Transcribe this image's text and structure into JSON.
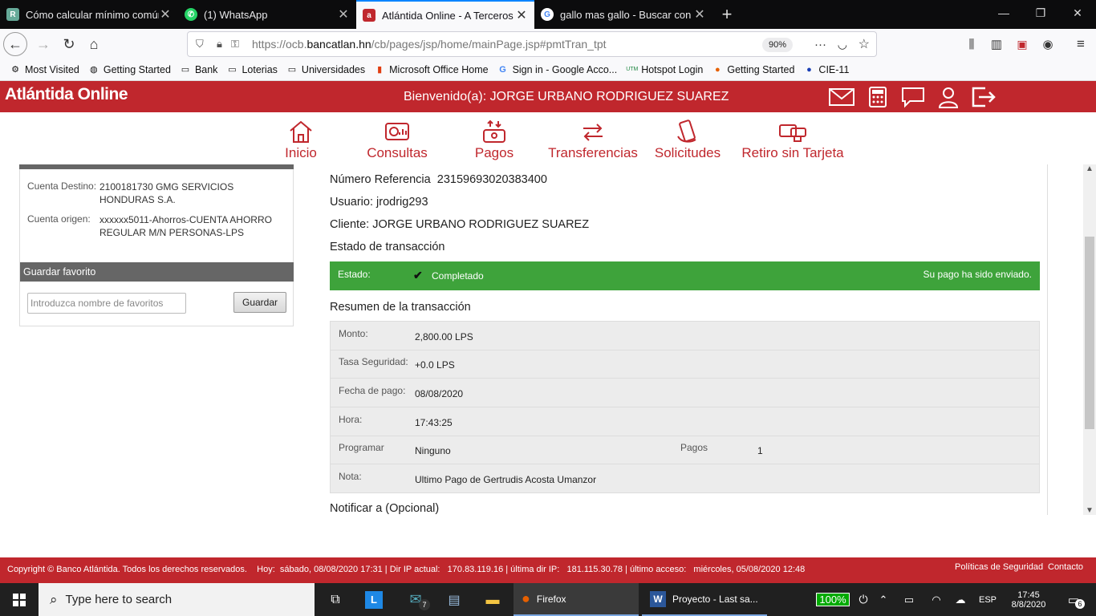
{
  "browser": {
    "tabs": [
      {
        "title": "Cómo calcular mínimo común",
        "icon": "r-favicon",
        "active": false
      },
      {
        "title": "(1) WhatsApp",
        "icon": "whatsapp-icon",
        "active": false
      },
      {
        "title": "Atlántida Online - A Terceros",
        "icon": "atlantida-icon",
        "active": true
      },
      {
        "title": "gallo mas gallo - Buscar con G",
        "icon": "google-icon",
        "active": false
      }
    ],
    "url_prefix": "https://ocb.",
    "url_domain": "bancatlan.hn",
    "url_path": "/cb/pages/jsp/home/mainPage.jsp#pmtTran_tpt",
    "zoom": "90%",
    "bookmarks": [
      "Most Visited",
      "Getting Started",
      "Bank",
      "Loterias",
      "Universidades",
      "Microsoft Office Home",
      "Sign in - Google Acco...",
      "Hotspot Login",
      "Getting Started",
      "CIE-11"
    ]
  },
  "site": {
    "logo": "Atlántida Online",
    "welcome": "Bienvenido(a): JORGE URBANO RODRIGUEZ SUAREZ",
    "menu": [
      "Inicio",
      "Consultas",
      "Pagos",
      "Transferencias",
      "Solicitudes",
      "Retiro sin Tarjeta"
    ]
  },
  "left": {
    "dest_label": "Cuenta Destino:",
    "dest_value": "2100181730 GMG SERVICIOS HONDURAS S.A.",
    "orig_label": "Cuenta origen:",
    "orig_value": "xxxxxx5011-Ahorros-CUENTA AHORRO REGULAR M/N PERSONAS-LPS",
    "fav_header": "Guardar favorito",
    "fav_placeholder": "Introduzca nombre de favoritos",
    "fav_button": "Guardar"
  },
  "main": {
    "ref_label": "Número Referencia",
    "ref_value": "23159693020383400",
    "user_label": "Usuario:",
    "user_value": "jrodrig293",
    "client_label": "Cliente:",
    "client_value": "JORGE URBANO RODRIGUEZ SUAREZ",
    "status_title": "Estado de transacción",
    "status_label": "Estado:",
    "status_value": "Completado",
    "status_msg": "Su pago ha sido enviado.",
    "summary_title": "Resumen de la transacción",
    "summary": {
      "monto_k": "Monto:",
      "monto_v": "2,800.00 LPS",
      "tasa_k": "Tasa Seguridad:",
      "tasa_v": "+0.0 LPS",
      "fecha_k": "Fecha de pago:",
      "fecha_v": "08/08/2020",
      "hora_k": "Hora:",
      "hora_v": "17:43:25",
      "prog_k": "Programar",
      "prog_v": "Ninguno",
      "pagos_k": "Pagos",
      "pagos_v": "1",
      "nota_k": "Nota:",
      "nota_v": "Ultimo Pago de Gertrudis Acosta Umanzor"
    },
    "notify": "Notificar a (Opcional)"
  },
  "footer": {
    "text": "Copyright © Banco Atlántida. Todos los derechos reservados.    Hoy:  sábado, 08/08/2020 17:31 | Dir IP actual:   170.83.119.16 | última dir IP:   181.115.30.78 | último acceso:   miércoles, 05/08/2020 12:48",
    "policy": "Políticas de Seguridad",
    "contact": "Contacto"
  },
  "taskbar": {
    "search": "Type here to search",
    "mail_badge": "7",
    "firefox": "Firefox",
    "word": "Proyecto  -  Last sa...",
    "battery": "100%",
    "lang": "ESP",
    "time": "17:45",
    "date": "8/8/2020",
    "notif": "6"
  }
}
